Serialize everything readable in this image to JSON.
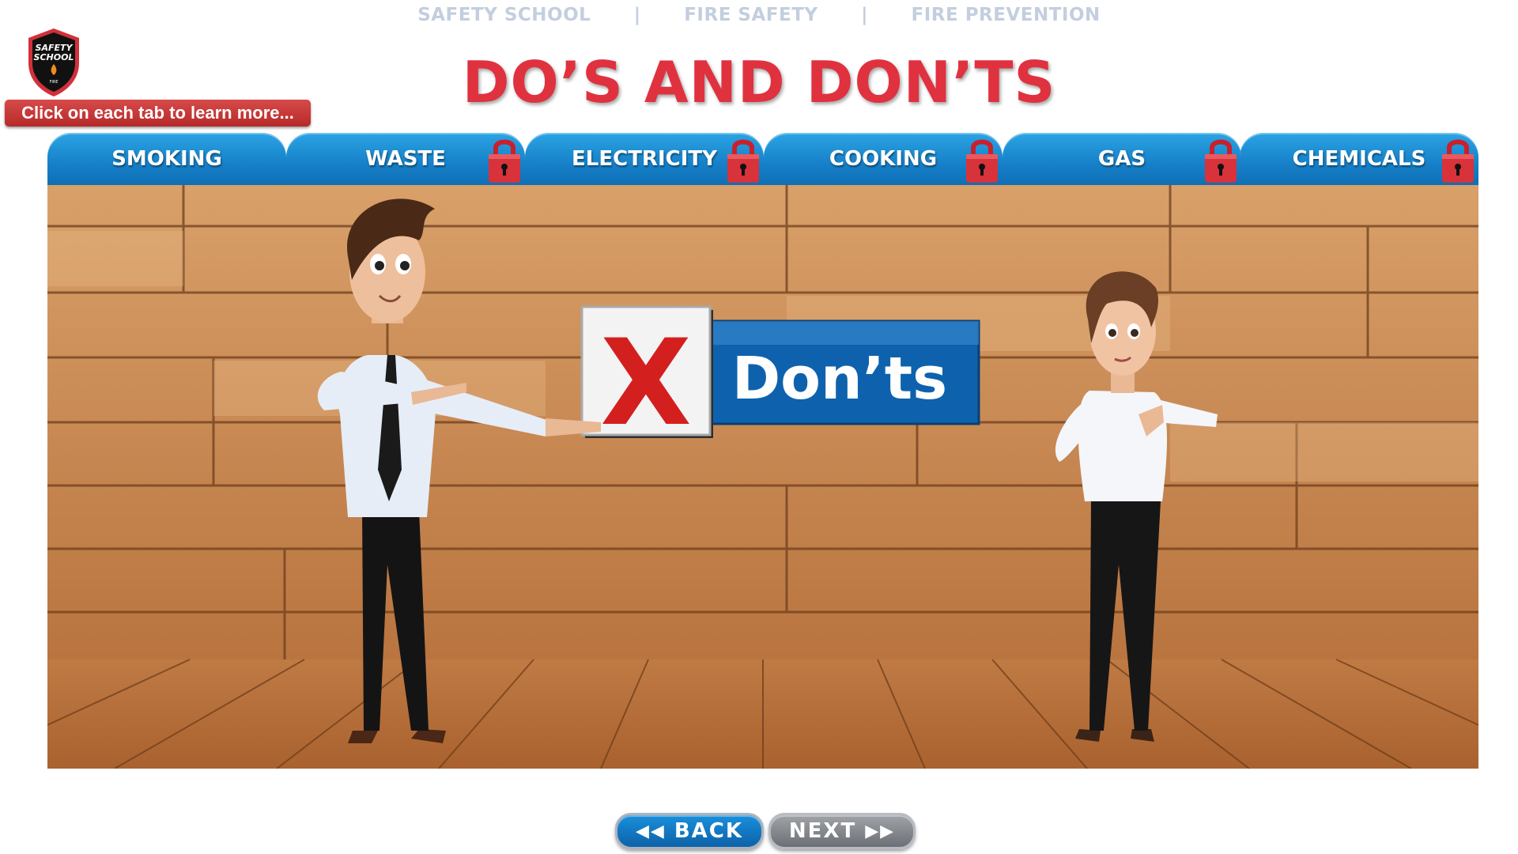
{
  "breadcrumb": {
    "items": [
      "SAFETY SCHOOL",
      "FIRE SAFETY",
      "FIRE PREVENTION"
    ],
    "separator": "|"
  },
  "logo": {
    "text_line1": "SAFETY",
    "text_line2": "SCHOOL",
    "text_line3": "FIRE"
  },
  "page_title": "DO’S AND DON’TS",
  "hint": "Click on each tab to learn more...",
  "tabs": [
    {
      "label": "SMOKING",
      "locked": false
    },
    {
      "label": "WASTE",
      "locked": true
    },
    {
      "label": "ELECTRICITY",
      "locked": true
    },
    {
      "label": "COOKING",
      "locked": true
    },
    {
      "label": "GAS",
      "locked": true
    },
    {
      "label": "CHEMICALS",
      "locked": true
    }
  ],
  "stage": {
    "sign_text": "Don’ts",
    "sign_mark": "X"
  },
  "nav": {
    "back_label": "BACK",
    "next_label": "NEXT",
    "back_icon": "double-left-chevron-icon",
    "next_icon": "double-right-chevron-icon"
  },
  "colors": {
    "tab_blue": "#1680c8",
    "title_red": "#e0313f",
    "lock_red": "#d8323a",
    "sign_blue": "#0e62ad"
  }
}
